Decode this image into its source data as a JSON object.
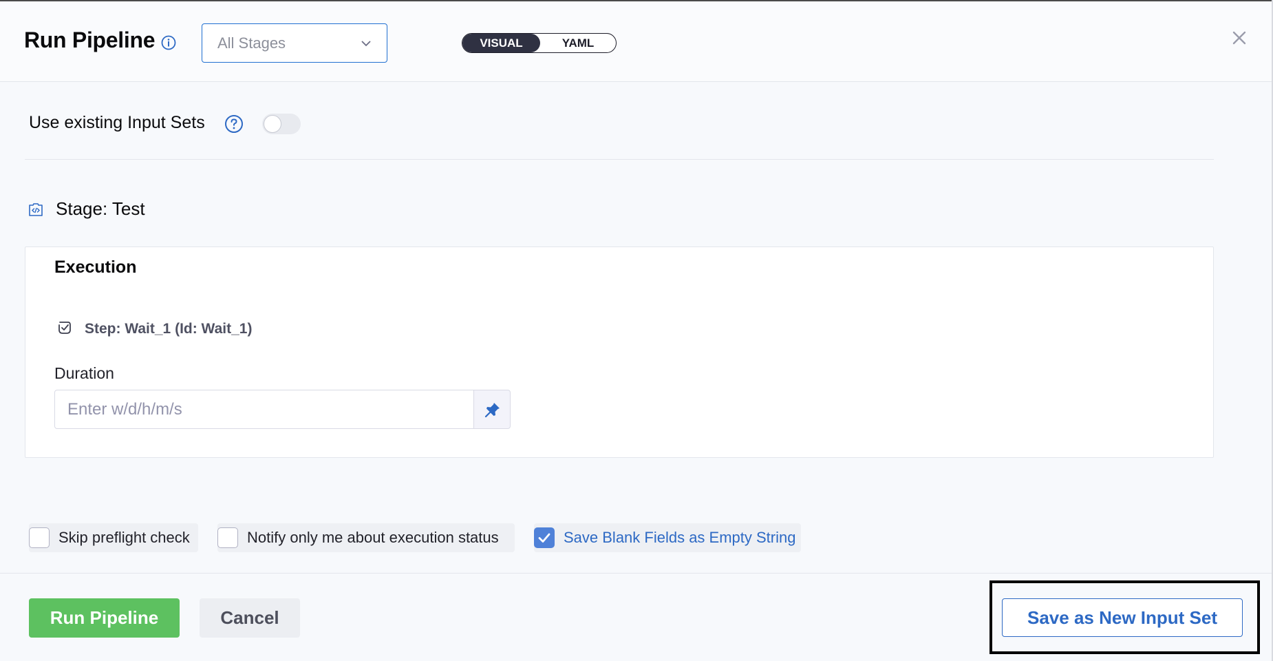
{
  "header": {
    "title": "Run Pipeline",
    "stage_select": {
      "value": "All Stages"
    },
    "view_toggle": {
      "visual_label": "VISUAL",
      "yaml_label": "YAML",
      "selected": "VISUAL"
    }
  },
  "input_sets": {
    "label": "Use existing Input Sets",
    "toggle_on": false
  },
  "stage": {
    "title": "Stage: Test",
    "section_title": "Execution",
    "step_label": "Step: Wait_1 (Id: Wait_1)",
    "duration": {
      "label": "Duration",
      "placeholder": "Enter w/d/h/m/s",
      "value": ""
    }
  },
  "options": [
    {
      "label": "Skip preflight check",
      "checked": false
    },
    {
      "label": "Notify only me about execution status",
      "checked": false
    },
    {
      "label": "Save Blank Fields as Empty String",
      "checked": true
    }
  ],
  "footer": {
    "run_label": "Run Pipeline",
    "cancel_label": "Cancel",
    "save_input_set_label": "Save as New Input Set"
  },
  "colors": {
    "primary_blue": "#2d69c4",
    "run_green": "#5dc160",
    "toggle_dark": "#2f3142"
  }
}
